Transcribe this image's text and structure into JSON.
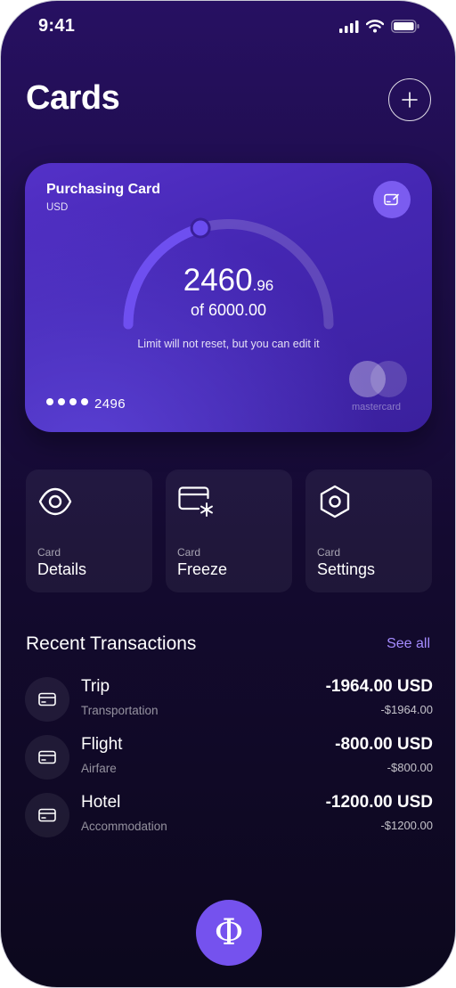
{
  "status_bar": {
    "time": "9:41"
  },
  "header": {
    "title": "Cards"
  },
  "card": {
    "name": "Purchasing Card",
    "currency": "USD",
    "spent_whole": "2460",
    "spent_cents": ".96",
    "limit_text": "of 6000.00",
    "spent_fraction": 0.41,
    "note": "Limit will not reset, but you can edit it",
    "last4": "2496",
    "network": "mastercard"
  },
  "actions": [
    {
      "small": "Card",
      "label": "Details",
      "icon": "eye-icon"
    },
    {
      "small": "Card",
      "label": "Freeze",
      "icon": "card-freeze-icon"
    },
    {
      "small": "Card",
      "label": "Settings",
      "icon": "hexagon-settings-icon"
    }
  ],
  "transactions": {
    "title": "Recent Transactions",
    "see_all": "See all",
    "items": [
      {
        "name": "Trip",
        "category": "Transportation",
        "amount": "-1964.00 USD",
        "sub": "-$1964.00"
      },
      {
        "name": "Flight",
        "category": "Airfare",
        "amount": "-800.00 USD",
        "sub": "-$800.00"
      },
      {
        "name": "Hotel",
        "category": "Accommodation",
        "amount": "-1200.00 USD",
        "sub": "-$1200.00"
      }
    ]
  },
  "fab": {
    "symbol": "Φ"
  },
  "colors": {
    "accent": "#7552ee",
    "link": "#a58cff",
    "card": "#4a2bbb"
  }
}
